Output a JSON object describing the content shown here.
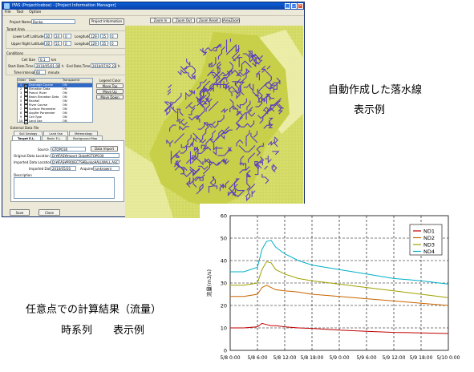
{
  "window": {
    "title": "IFAS (ProjectIcebox) - [Project Information Manager]",
    "menu": [
      "File",
      "Tool",
      "Option"
    ],
    "project_name_label": "Project Name",
    "project_name": "Bunko",
    "project_info_button": "Project Information",
    "target_area_label": "Target Area",
    "lower_left_lat_label": "Lower Left Latitude",
    "lower_left_lat": [
      "30",
      "24",
      "0"
    ],
    "lower_left_lon_label": "Longitude",
    "lower_left_lon": [
      "129",
      "15",
      "0"
    ],
    "upper_right_lat_label": "Upper Right Latitude",
    "upper_right_lat": [
      "30",
      "55",
      "0"
    ],
    "upper_right_lon_label": "Longitude",
    "upper_right_lon": [
      "129",
      "35",
      "0"
    ],
    "conditions_label": "Conditions",
    "cell_size_label": "Cell Size",
    "cell_size": "0.1",
    "cell_size_unit": "km",
    "start_label": "Start Date,Time",
    "start_value": "2010/05/01 00",
    "start_unit": "h",
    "end_label": "End Date,Time",
    "end_value": "2010/07/02 23",
    "end_unit": "h",
    "interval_label": "Time Interval",
    "interval_value": "60",
    "interval_unit": "minute",
    "layer_table": {
      "headers": [
        "Order",
        "",
        "Data",
        "Transparent"
      ],
      "rows": [
        {
          "order": "1",
          "name": "Drainage Course",
          "trans": "ON"
        },
        {
          "order": "2",
          "name": "Elevation Data",
          "trans": "ON"
        },
        {
          "order": "3",
          "name": "Pseud. River",
          "trans": "ON"
        },
        {
          "order": "4",
          "name": "Basin Elevation Data",
          "trans": "ON"
        },
        {
          "order": "5",
          "name": "Rainfall",
          "trans": "ON"
        },
        {
          "order": "6",
          "name": "River Course Parameter",
          "trans": "ON"
        },
        {
          "order": "7",
          "name": "Surface Parameter",
          "trans": "ON"
        },
        {
          "order": "8",
          "name": "Aquifer Parameter",
          "trans": "ON"
        },
        {
          "order": "9",
          "name": "Cell Type",
          "trans": "ON"
        },
        {
          "order": "10",
          "name": "Land Use",
          "trans": "ON"
        }
      ]
    },
    "legend_color_label": "Legend Color",
    "move_top": "Move Top",
    "move_up": "Move Up",
    "move_down": "Move Down",
    "external_data_label": "External Data File",
    "tabs_row1": [
      "Soil Geology",
      "Land Use",
      "Meteorology"
    ],
    "tabs_row2": [
      "Target E.L.",
      "Basin E.L.",
      "Background Map"
    ],
    "source_label": "Source",
    "source_value": "GTOPO30",
    "data_import_button": "Data Import",
    "original_loc_label": "Original Data Location",
    "original_loc_value": "D:¥IFAS¥Import_Data¥GTOPO30",
    "imported_loc_label": "Imported Data Location",
    "imported_loc_value": "D:¥IFAS¥PROJECTS¥Bunko¥ALLWALL.ASC",
    "imported_date_label": "Imported Date",
    "imported_date_value": "2010/05/20",
    "acquirer_label": "Acquirer",
    "acquirer_value": "(unknown)",
    "description_label": "Description",
    "save_button": "Save",
    "close_button": "Close",
    "map_buttons": [
      "Zoom In",
      "Zoom Out",
      "Zoom Reset",
      "AreaZoom"
    ]
  },
  "captions": {
    "right_line1": "自動作成した落水線",
    "right_line2": "表示例",
    "left_line1": "任意点での計算結果（流量）",
    "left_line2": "時系列　　表示例"
  },
  "chart_data": {
    "type": "line",
    "title": "",
    "xlabel": "",
    "ylabel": "流量(m3/s)",
    "ylim": [
      0,
      60
    ],
    "yticks": [
      "0",
      "10",
      "20",
      "30",
      "40",
      "50",
      "60"
    ],
    "xticks": [
      "5/8 0:00",
      "5/8 6:00",
      "5/8 12:00",
      "5/8 18:00",
      "5/9 0:00",
      "5/9 6:00",
      "5/9 12:00",
      "5/9 18:00",
      "5/10 0:00"
    ],
    "x": [
      0,
      3,
      6,
      7,
      8,
      9,
      10,
      12,
      15,
      18,
      24,
      30,
      36,
      42,
      48
    ],
    "series": [
      {
        "name": "ND1",
        "color": "#c00000",
        "values": [
          10,
          10,
          10.5,
          12,
          11.5,
          11,
          11,
          10.5,
          10,
          9.8,
          9,
          8.5,
          8,
          7.8,
          7.5
        ]
      },
      {
        "name": "ND2",
        "color": "#c86400",
        "values": [
          24,
          24,
          25,
          28,
          29,
          28,
          27,
          26.5,
          26,
          25,
          24,
          23,
          22,
          21,
          20
        ]
      },
      {
        "name": "ND3",
        "color": "#a0a000",
        "values": [
          29,
          29,
          30,
          36,
          39.5,
          39,
          36,
          34,
          32,
          31,
          29.5,
          28,
          26.5,
          25,
          23.5
        ]
      },
      {
        "name": "ND4",
        "color": "#00b0c8",
        "values": [
          35,
          35,
          37,
          45,
          48.5,
          49,
          46,
          43,
          40,
          38,
          36,
          34,
          32,
          31,
          29.5
        ]
      }
    ],
    "grid": true,
    "legend": "top-right"
  }
}
